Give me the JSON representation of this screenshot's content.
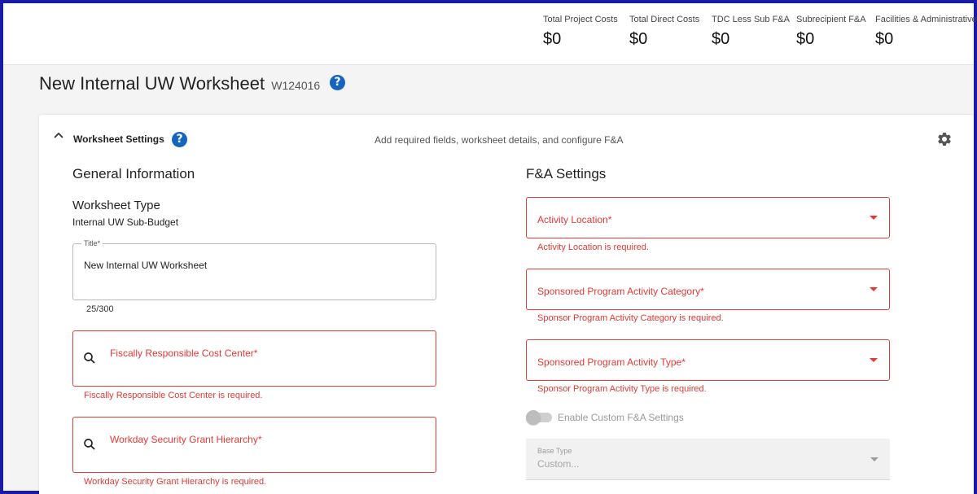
{
  "header": {
    "costs": [
      {
        "label": "Total Project Costs",
        "value": "$0"
      },
      {
        "label": "Total Direct Costs",
        "value": "$0"
      },
      {
        "label": "TDC Less Sub F&A",
        "value": "$0"
      },
      {
        "label": "Subrecipient F&A",
        "value": "$0"
      },
      {
        "label": "Facilities & Administrative",
        "value": "$0"
      }
    ]
  },
  "page": {
    "title": "New Internal UW Worksheet",
    "worksheet_id": "W124016",
    "help_icon": "?"
  },
  "settings": {
    "section_title": "Worksheet Settings",
    "subtitle": "Add required fields, worksheet details, and configure F&A",
    "icons": {
      "collapse": "chevron-up-icon",
      "help": "help-icon",
      "settings": "gear-icon"
    }
  },
  "general": {
    "heading": "General Information",
    "worksheet_type_label": "Worksheet Type",
    "worksheet_type_value": "Internal UW Sub-Budget",
    "title_field": {
      "label": "Title*",
      "value": "New Internal UW Worksheet",
      "counter": "25/300"
    },
    "cost_center": {
      "label": "Fiscally Responsible Cost Center*",
      "error": "Fiscally Responsible Cost Center is required."
    },
    "grant_hierarchy": {
      "label": "Workday Security Grant Hierarchy*",
      "error": "Workday Security Grant Hierarchy is required."
    }
  },
  "fa": {
    "heading": "F&A Settings",
    "activity_location": {
      "label": "Activity Location*",
      "error": "Activity Location is required."
    },
    "activity_category": {
      "label": "Sponsored Program Activity Category*",
      "error": "Sponsor Program Activity Category is required."
    },
    "activity_type": {
      "label": "Sponsored Program Activity Type*",
      "error": "Sponsor Program Activity Type is required."
    },
    "custom_toggle": {
      "label": "Enable Custom F&A Settings",
      "enabled": false
    },
    "base_type": {
      "label": "Base Type",
      "value": "Custom..."
    }
  },
  "colors": {
    "error": "#e53935",
    "accent": "#1565c0",
    "frame": "#1a1aa6"
  }
}
